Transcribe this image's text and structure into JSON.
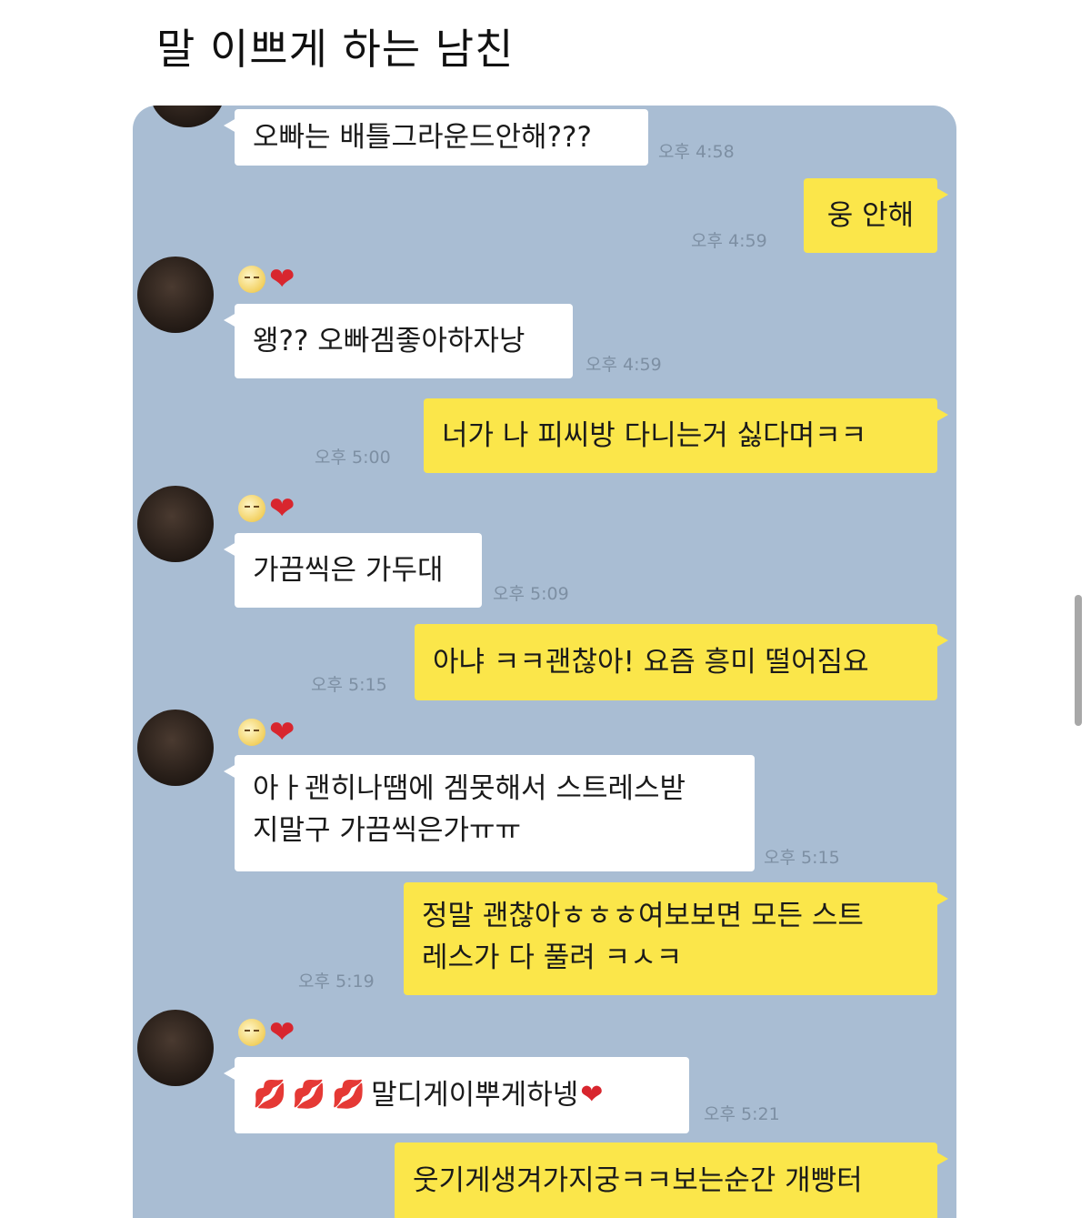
{
  "post": {
    "title": "말 이쁘게 하는 남친"
  },
  "messages": [
    {
      "side": "left",
      "text": "오빠는 배틀그라운드안해???",
      "time": "오후 4:58"
    },
    {
      "side": "right",
      "text": "웅 안해",
      "time": "오후 4:59"
    },
    {
      "side": "left",
      "text": "왱?? 오빠겜좋아하자낭",
      "time": "오후 4:59"
    },
    {
      "side": "right",
      "text": "너가 나 피씨방 다니는거 싫다며ㅋㅋ",
      "time": "오후 5:00"
    },
    {
      "side": "left",
      "text": "가끔씩은 가두대",
      "time": "오후 5:09"
    },
    {
      "side": "right",
      "text": "아냐 ㅋㅋ괜찮아! 요즘 흥미 떨어짐요",
      "time": "오후 5:15"
    },
    {
      "side": "left",
      "lines": [
        "아ㅏ괜히나땜에 겜못해서 스트레스받",
        "지말구 가끔씩은가ㅠㅠ"
      ],
      "time": "오후 5:15"
    },
    {
      "side": "right",
      "lines": [
        "정말 괜찮아ㅎㅎㅎ여보보면 모든 스트",
        "레스가 다 풀려 ㅋㅅㅋ"
      ],
      "time": "오후 5:19"
    },
    {
      "side": "left",
      "text": "말디게이뿌게하넹",
      "time": "오후 5:21"
    },
    {
      "side": "right",
      "text": "웃기게생겨가지궁ㅋㅋ보는순간 개빵터"
    }
  ],
  "decor": {
    "emoji_face_icon": "smiling-face-icon",
    "heart_icon": "red-heart-icon",
    "lips_icon": "kiss-lips-icon",
    "heart_glyph": "❤",
    "lips_glyph": "💋",
    "colors": {
      "chat_bg": "#a9bdd3",
      "sent_bubble": "#fbe64a",
      "received_bubble": "#ffffff"
    }
  }
}
